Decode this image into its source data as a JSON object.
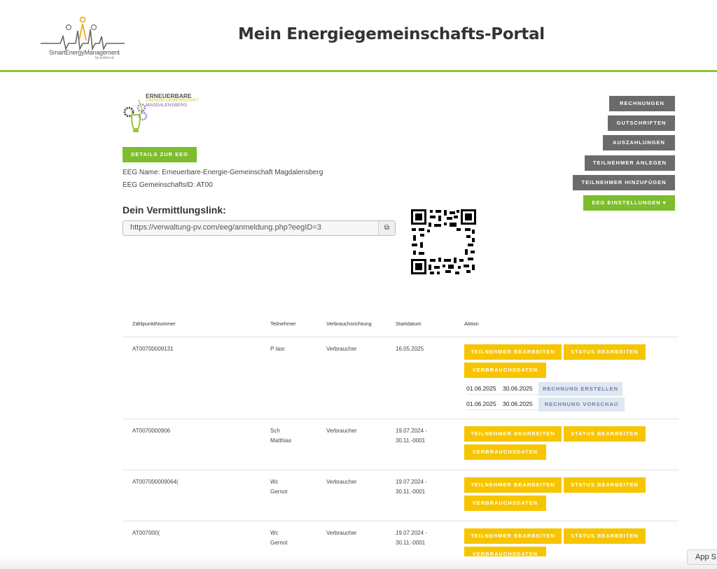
{
  "header": {
    "logo_text": "SmartEnergyManagement",
    "logo_sub": "by promo.at",
    "title": "Mein Energiegemeinschafts-Portal"
  },
  "eeg": {
    "logo_line1": "ERNEUERBARE",
    "logo_line2": "ENERGIE-GEMEINSCHAFT",
    "logo_line3": "MAGDALENSBERG",
    "details_button": "DETAILS ZUR EEG",
    "name_line": "EEG Name: Erneuerbare-Energie-Gemeinschaft Magdalensberg",
    "id_line": "EEG GemeinschaftsID: AT00"
  },
  "actions": {
    "rechnungen": "RECHNUNGEN",
    "gutschriften": "GUTSCHRIFTEN",
    "auszahlungen": "AUSZAHLUNGEN",
    "teilnehmer_anlegen": "TEILNEHMER ANLEGEN",
    "teilnehmer_hinzufuegen": "TEILNEHMER HINZUFÜGEN",
    "eeg_einstellungen": "EEG EINSTELLUNGEN ▾"
  },
  "link": {
    "heading": "Dein Vermittlungslink:",
    "url": "https://verwaltung-pv.com/eeg/anmeldung.php?eegID=3",
    "copy_icon": "⧉"
  },
  "table": {
    "headers": [
      "ZählpunktNummer",
      "Teilnehmer",
      "Verbrauchsrichtung",
      "Startdatum",
      "Aktion"
    ],
    "rows": [
      {
        "zaehlpunkt": "AT00700009131",
        "teilnehmer1": "P    Iasr",
        "teilnehmer2": "",
        "richtung": "Verbraucher",
        "start1": "16.05.2025",
        "start2": ""
      },
      {
        "zaehlpunkt": "AT0070000906",
        "teilnehmer1": "Sch",
        "teilnehmer2": "Matthias",
        "richtung": "Verbraucher",
        "start1": "19.07.2024 -",
        "start2": "30.11.-0001"
      },
      {
        "zaehlpunkt": "AT007000009064(",
        "teilnehmer1": "Wc",
        "teilnehmer2": "Gernot",
        "richtung": "Verbraucher",
        "start1": "19.07.2024 -",
        "start2": "30.11.-0001"
      },
      {
        "zaehlpunkt": "AT007000(",
        "teilnehmer1": "Wc",
        "teilnehmer2": "Gernot",
        "richtung": "Verbraucher",
        "start1": "19.07.2024 -",
        "start2": "30.11.-0001"
      }
    ],
    "btn_teilnehmer": "TEILNEHMER BEARBEITEN",
    "btn_status": "STATUS BEARBEITEN",
    "btn_verbrauch": "VERBRAUCHSDATEN",
    "invoice": {
      "from": "01.06.2025",
      "to": "30.06.2025",
      "create": "RECHNUNG ERSTELLEN",
      "preview": "RECHNUNG VORSCHAU"
    }
  },
  "footer": {
    "app_tab": "App S"
  }
}
